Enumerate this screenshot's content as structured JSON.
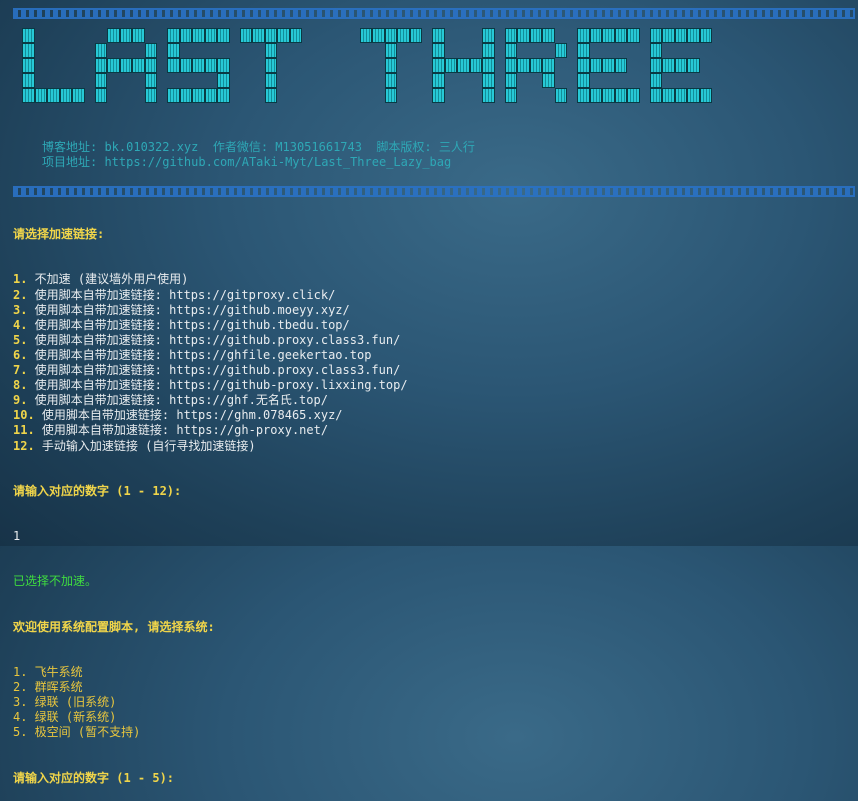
{
  "banner": {
    "title": "LAST THREE"
  },
  "info": {
    "line1": "博客地址: bk.010322.xyz  作者微信: M13051661743  脚本版权: 三人行",
    "line2": "项目地址: https://github.com/ATaki-Myt/Last_Three_Lazy_bag"
  },
  "terminal": {
    "prompt1": "请选择加速链接:",
    "options": [
      {
        "num": "1.",
        "text": " 不加速 (建议墙外用户使用)"
      },
      {
        "num": "2.",
        "text": " 使用脚本自带加速链接: https://gitproxy.click/"
      },
      {
        "num": "3.",
        "text": " 使用脚本自带加速链接: https://github.moeyy.xyz/"
      },
      {
        "num": "4.",
        "text": " 使用脚本自带加速链接: https://github.tbedu.top/"
      },
      {
        "num": "5.",
        "text": " 使用脚本自带加速链接: https://github.proxy.class3.fun/"
      },
      {
        "num": "6.",
        "text": " 使用脚本自带加速链接: https://ghfile.geekertao.top"
      },
      {
        "num": "7.",
        "text": " 使用脚本自带加速链接: https://github.proxy.class3.fun/"
      },
      {
        "num": "8.",
        "text": " 使用脚本自带加速链接: https://github-proxy.lixxing.top/"
      },
      {
        "num": "9.",
        "text": " 使用脚本自带加速链接: https://ghf.无名氏.top/"
      },
      {
        "num": "10.",
        "text": " 使用脚本自带加速链接: https://ghm.078465.xyz/"
      },
      {
        "num": "11.",
        "text": " 使用脚本自带加速链接: https://gh-proxy.net/"
      },
      {
        "num": "12.",
        "text": " 手动输入加速链接 (自行寻找加速链接)"
      }
    ],
    "input_prompt1": "请输入对应的数字 (1 - 12):",
    "input_value1": "1",
    "selected_msg": "已选择不加速。",
    "welcome": "欢迎使用系统配置脚本, 请选择系统:",
    "systems": [
      "1. 飞牛系统",
      "2. 群晖系统",
      "3. 绿联 (旧系统)",
      "4. 绿联 (新系统)",
      "5. 极空间 (暂不支持)"
    ],
    "input_prompt2": "请输入对应的数字 (1 - 5):"
  },
  "colors": {
    "banner": "#1fb8c4",
    "info": "#2ea8b6",
    "prompt": "#f0d54a",
    "success": "#3fdc3f",
    "separator": "#2a72c6"
  }
}
